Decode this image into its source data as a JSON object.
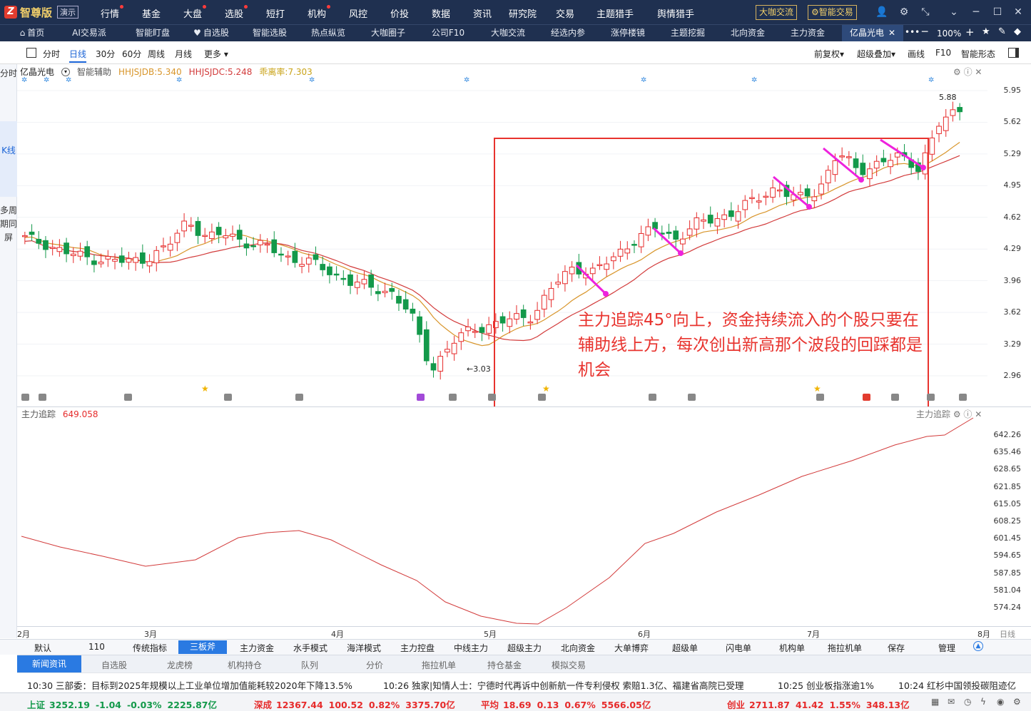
{
  "app": {
    "logo_text": "智尊版",
    "logo_badge": "演示",
    "menu": [
      "行情",
      "基金",
      "大盘",
      "选股",
      "短打",
      "机构",
      "风控",
      "价投",
      "数据",
      "资讯",
      "研究院",
      "交易",
      "主题猎手",
      "舆情猎手"
    ],
    "menu_dots": [
      true,
      false,
      true,
      true,
      false,
      true,
      false,
      false,
      false,
      false,
      false,
      false,
      false,
      false
    ],
    "btn_dakajiaoliu": "大咖交流",
    "btn_zhinengjiaoyi": "智能交易",
    "zoom": "100%"
  },
  "tabs": [
    "首页",
    "AI交易派",
    "智能盯盘",
    "自选股",
    "智能选股",
    "热点纵览",
    "大咖圈子",
    "公司F10",
    "大咖交流",
    "经选内参",
    "涨停楼镜",
    "主题挖掘",
    "北向资金",
    "主力资金",
    "亿晶光电"
  ],
  "toolbar": {
    "periods": [
      "分时",
      "日线",
      "30分",
      "60分",
      "周线",
      "月线",
      "更多"
    ],
    "active_period": "日线",
    "right": [
      "前复权",
      "超级叠加",
      "画线",
      "F10",
      "智能形态"
    ]
  },
  "sidebar": [
    "分时",
    "K线",
    "多周期同屏"
  ],
  "stock": {
    "name": "亿晶光电",
    "assist": "智能辅助",
    "ind1": "HHJSJDB:5.340",
    "ind2": "HHJSJDC:5.248",
    "ind3": "乖离率:7.303",
    "high_label": "5.88",
    "low_label": "3.03"
  },
  "main_yaxis": [
    "5.95",
    "5.62",
    "5.29",
    "4.95",
    "4.62",
    "4.29",
    "3.96",
    "3.62",
    "3.29",
    "2.96"
  ],
  "sub_indicator": {
    "name": "主力追踪",
    "value": "649.058",
    "right_label": "主力追踪"
  },
  "sub_yaxis": [
    "642.26",
    "635.46",
    "628.65",
    "621.85",
    "615.05",
    "608.25",
    "601.45",
    "594.65",
    "587.85",
    "581.04",
    "574.24"
  ],
  "date_axis": [
    "2月",
    "3月",
    "4月",
    "5月",
    "6月",
    "7月",
    "8月"
  ],
  "date_axis_right": "日线",
  "annotation": "主力追踪45°向上，资金持续流入的个股只要在辅助线上方，每次创出新高那个波段的回踩都是机会",
  "indicator_tabs": [
    "默认",
    "110",
    "传统指标",
    "三板斧",
    "主力资金",
    "水手模式",
    "海洋模式",
    "主力控盘",
    "中线主力",
    "超级主力",
    "北向资金",
    "大单博弈",
    "超级单",
    "闪电单",
    "机构单",
    "拖拉机单",
    "保存",
    "管理"
  ],
  "active_indicator_tab": "三板斧",
  "news_tabs": [
    "新闻资讯",
    "自选股",
    "龙虎榜",
    "机构持仓",
    "队列",
    "分价",
    "拖拉机单",
    "持仓基金",
    "模拟交易"
  ],
  "news": [
    "10:30 三部委：目标到2025年规模以上工业单位增加值能耗较2020年下降13.5%",
    "10:26 独家|知情人士：宁德时代再诉中创新航一件专利侵权 索赔1.3亿、福建省高院已受理",
    "10:25 创业板指涨逾1%",
    "10:24 红杉中国领投碳阻迹亿"
  ],
  "indices": [
    {
      "name": "上证",
      "value": "3252.19",
      "chg": "-1.04",
      "pct": "-0.03%",
      "amt": "2225.87亿"
    },
    {
      "name": "深成",
      "value": "12367.44",
      "chg": "100.52",
      "pct": "0.82%",
      "amt": "3375.70亿"
    },
    {
      "name": "平均",
      "value": "18.69",
      "chg": "0.13",
      "pct": "0.67%",
      "amt": "5566.05亿"
    },
    {
      "name": "创业",
      "value": "2711.87",
      "chg": "41.42",
      "pct": "1.55%",
      "amt": "348.13亿"
    }
  ],
  "colors": {
    "up": "#e62b2b",
    "down": "#13994a",
    "ma1": "#d8952a",
    "ma2": "#d23a3a",
    "annotation": "#e8332e",
    "arrow": "#ee22dd"
  },
  "chart_data": {
    "type": "line",
    "title": "",
    "candles_close_trend": [
      4.4,
      4.35,
      4.25,
      4.2,
      4.18,
      4.15,
      4.2,
      4.3,
      4.6,
      4.4,
      4.45,
      4.35,
      4.3,
      4.2,
      4.15,
      4.05,
      3.95,
      3.88,
      3.85,
      3.6,
      3.03,
      3.3,
      3.45,
      3.5,
      3.55,
      3.6,
      3.9,
      4.1,
      4.05,
      4.2,
      4.4,
      4.5,
      4.4,
      4.55,
      4.6,
      4.7,
      4.8,
      4.95,
      4.8,
      4.9,
      5.3,
      5.1,
      5.2,
      5.25,
      5.15,
      5.6,
      5.75
    ],
    "ylim": [
      2.96,
      5.95
    ],
    "sub_series_range": [
      574.24,
      649.058
    ]
  }
}
